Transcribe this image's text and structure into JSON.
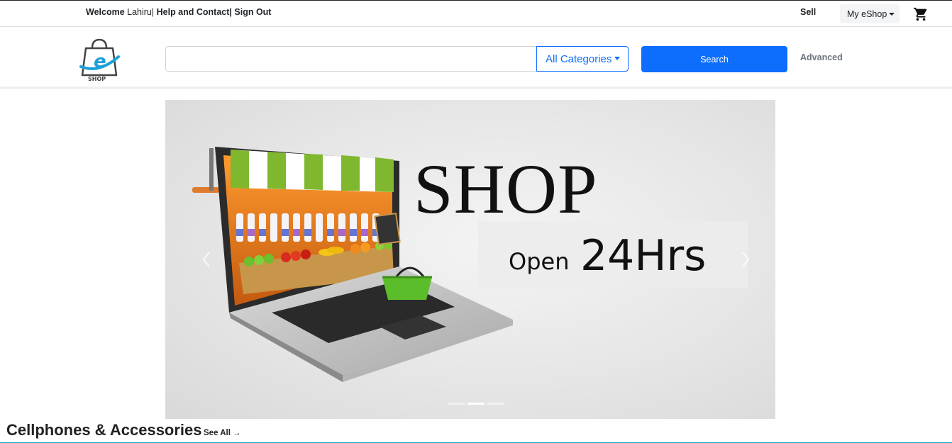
{
  "topbar": {
    "welcome": "Welcome",
    "user": "Lahiru|",
    "help": "Help and Contact|",
    "signout": "Sign Out",
    "sell": "Sell",
    "my_eshop": "My eShop",
    "cart_icon": "cart-icon"
  },
  "logo": {
    "text": "SHOP",
    "letter": "e",
    "icon": "eshop-bag-logo"
  },
  "search": {
    "value": "",
    "placeholder": "",
    "category": "All Categories",
    "button": "Search",
    "advanced": "Advanced"
  },
  "banner": {
    "headline": "SHOP",
    "open_text": "Open",
    "hours_text": "24Hrs",
    "slide_count": 3,
    "active_slide": 2
  },
  "section": {
    "title": "Cellphones & Accessories",
    "see_all": "See All →"
  },
  "colors": {
    "primary": "#0d6efd",
    "accent_line": "#17a2b8",
    "logo_blue": "#1ea0d8"
  }
}
